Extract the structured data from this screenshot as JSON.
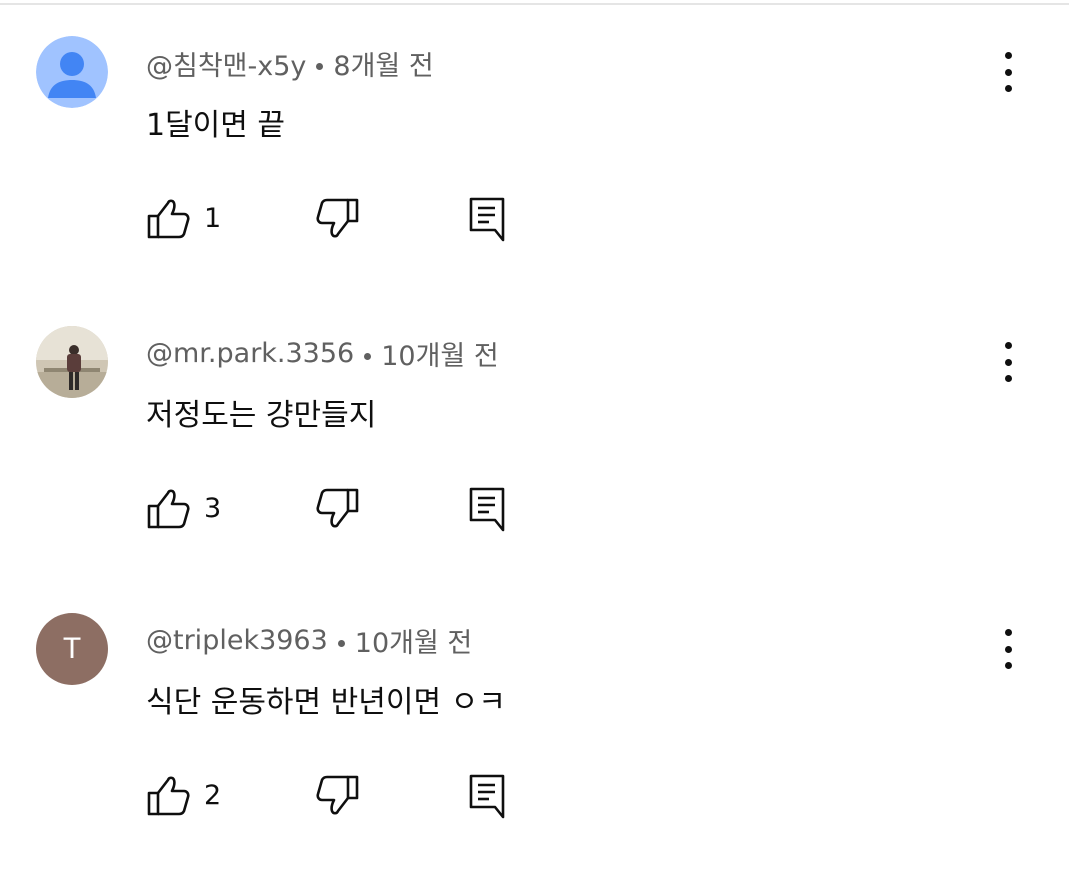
{
  "comments": [
    {
      "author": "@침착맨-x5y",
      "time": "8개월 전",
      "text": "1달이면 끝",
      "likes": "1",
      "avatar": {
        "type": "default-person",
        "bg": "#a0c3ff",
        "fg": "#4285f4"
      }
    },
    {
      "author": "@mr.park.3356",
      "time": "10개월 전",
      "text": "저정도는 걍만들지",
      "likes": "3",
      "avatar": {
        "type": "photo"
      }
    },
    {
      "author": "@triplek3963",
      "time": "10개월 전",
      "text": "식단 운동하면 반년이면 ㅇㅋ",
      "likes": "2",
      "avatar": {
        "type": "letter",
        "letter": "T",
        "bg": "#8d6e63"
      }
    }
  ],
  "icons": {
    "like": "thumb-up-icon",
    "dislike": "thumb-down-icon",
    "reply": "reply-comment-icon",
    "more": "more-vertical-icon"
  }
}
